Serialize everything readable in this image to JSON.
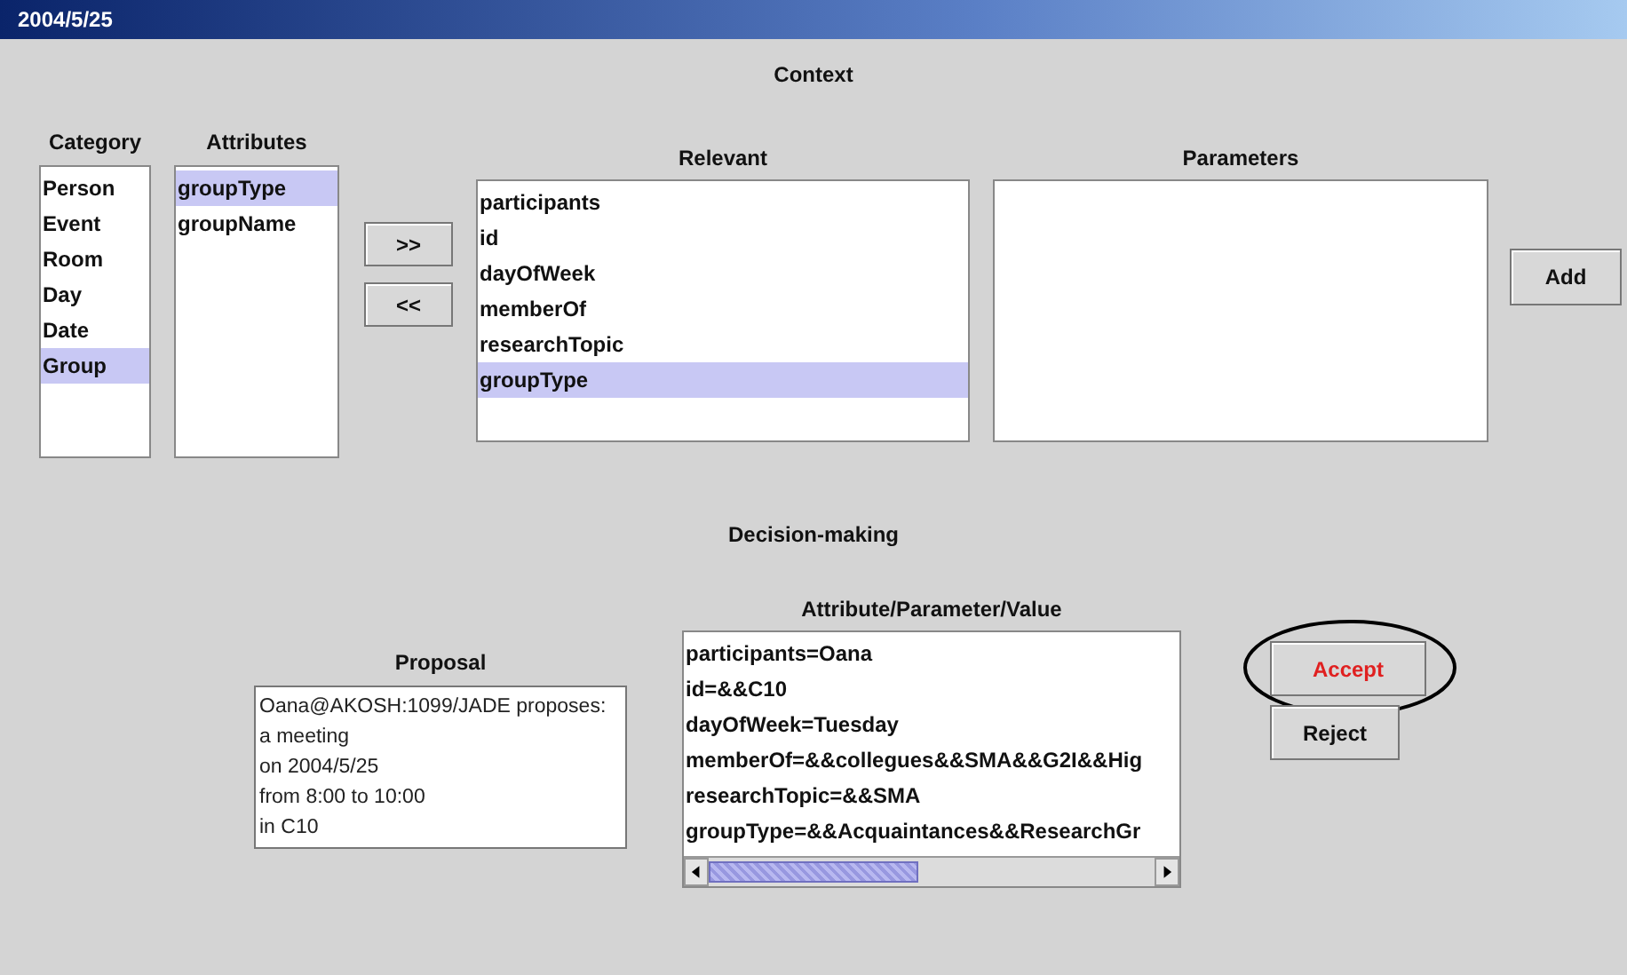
{
  "window": {
    "title": "2004/5/25"
  },
  "context": {
    "title": "Context",
    "category": {
      "label": "Category",
      "items": [
        {
          "text": "Person",
          "selected": false
        },
        {
          "text": "Event",
          "selected": false
        },
        {
          "text": "Room",
          "selected": false
        },
        {
          "text": "Day",
          "selected": false
        },
        {
          "text": "Date",
          "selected": false
        },
        {
          "text": "Group",
          "selected": true
        }
      ]
    },
    "attributes": {
      "label": "Attributes",
      "items": [
        {
          "text": "groupType",
          "selected": true
        },
        {
          "text": "groupName",
          "selected": false
        }
      ]
    },
    "move_buttons": [
      ">>",
      "<<"
    ],
    "relevant": {
      "label": "Relevant",
      "items": [
        {
          "text": "participants",
          "selected": false
        },
        {
          "text": "id",
          "selected": false
        },
        {
          "text": "dayOfWeek",
          "selected": false
        },
        {
          "text": "memberOf",
          "selected": false
        },
        {
          "text": "researchTopic",
          "selected": false
        },
        {
          "text": "groupType",
          "selected": true
        }
      ]
    },
    "parameters": {
      "label": "Parameters"
    },
    "add_button": "Add"
  },
  "decision": {
    "title": "Decision-making",
    "proposal": {
      "label": "Proposal",
      "lines": [
        "Oana@AKOSH:1099/JADE proposes:",
        "a meeting",
        "on 2004/5/25",
        "from 8:00 to 10:00",
        "in C10"
      ]
    },
    "values": {
      "label": "Attribute/Parameter/Value",
      "items": [
        {
          "text": "participants=Oana",
          "selected": false
        },
        {
          "text": "id=&&C10",
          "selected": false
        },
        {
          "text": "dayOfWeek=Tuesday",
          "selected": false
        },
        {
          "text": "memberOf=&&collegues&&SMA&&G2I&&Hig",
          "selected": false
        },
        {
          "text": "researchTopic=&&SMA",
          "selected": false
        },
        {
          "text": "groupType=&&Acquaintances&&ResearchGr",
          "selected": false
        }
      ]
    },
    "buttons": [
      {
        "label": "Accept",
        "kind": "accept",
        "circled": true
      },
      {
        "label": "Reject",
        "kind": "reject",
        "circled": false
      }
    ]
  }
}
